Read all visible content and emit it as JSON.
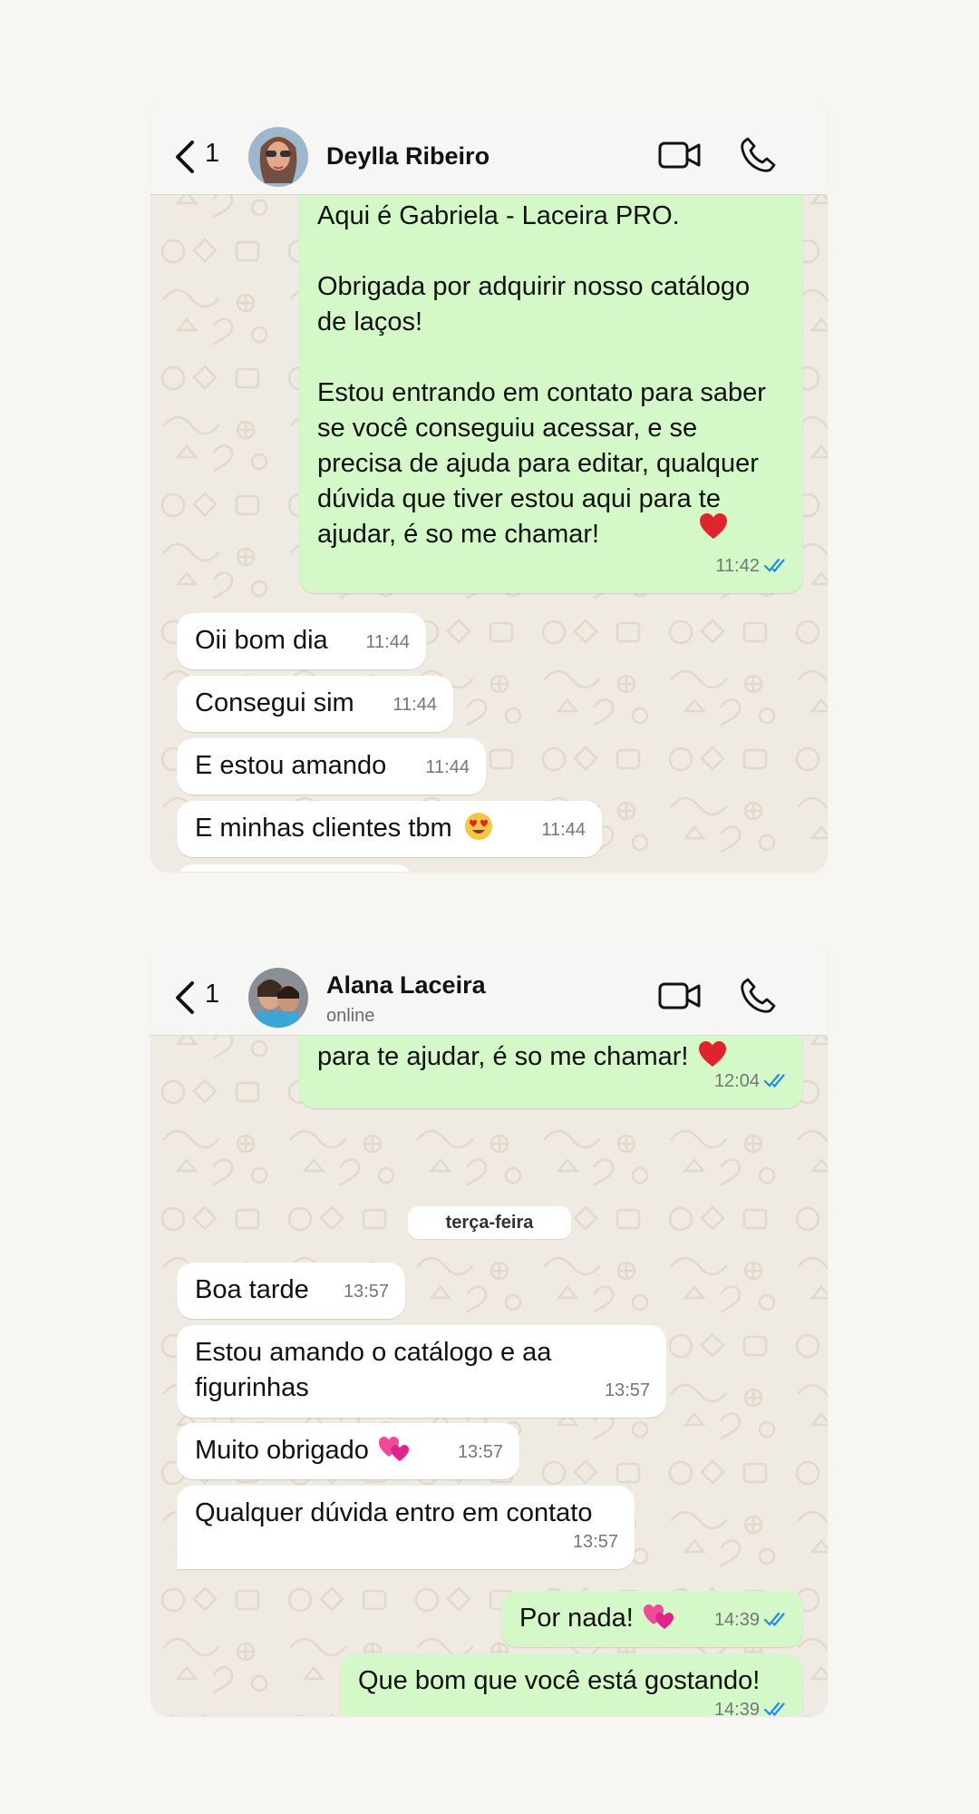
{
  "chats": [
    {
      "contact": {
        "name": "Deylla Ribeiro",
        "status": ""
      },
      "back_count": "1",
      "messages": [
        {
          "text": "Aqui é Gabriela - Laceira PRO.\n\nObrigada por adquirir nosso catálogo de laços!\n\nEstou entrando em contato para saber se você conseguiu acessar, e se precisa de ajuda para editar, qualquer dúvida que tiver estou aqui para te ajudar, é so me chamar!",
          "emoji": "heart",
          "time": "11:42",
          "direction": "outgoing"
        },
        {
          "text": "Oii bom dia",
          "time": "11:44",
          "direction": "incoming"
        },
        {
          "text": "Consegui sim",
          "time": "11:44",
          "direction": "incoming"
        },
        {
          "text": "E estou amando",
          "time": "11:44",
          "direction": "incoming"
        },
        {
          "text": "E minhas clientes tbm",
          "emoji": "heart-eyes",
          "time": "11:44",
          "direction": "incoming"
        }
      ]
    },
    {
      "contact": {
        "name": "Alana Laceira",
        "status": "online"
      },
      "back_count": "1",
      "date_separator": "terça-feira",
      "messages": [
        {
          "text": "para te ajudar, é so me chamar!",
          "emoji": "heart",
          "time": "12:04",
          "direction": "outgoing"
        },
        {
          "text": "Boa tarde",
          "time": "13:57",
          "direction": "incoming"
        },
        {
          "text": "Estou amando o catálogo e aa figurinhas",
          "time": "13:57",
          "direction": "incoming"
        },
        {
          "text": "Muito obrigado",
          "emoji": "two-hearts",
          "time": "13:57",
          "direction": "incoming"
        },
        {
          "text": "Qualquer dúvida entro em contato",
          "time": "13:57",
          "direction": "incoming"
        },
        {
          "text": "Por nada!",
          "emoji": "two-hearts",
          "time": "14:39",
          "direction": "outgoing"
        },
        {
          "text": "Que bom que você está gostando!",
          "time": "14:39",
          "direction": "outgoing"
        }
      ]
    }
  ],
  "icons": [
    "back-chevron-icon",
    "video-call-icon",
    "phone-icon",
    "read-ticks-icon"
  ],
  "colors": {
    "outgoing_bubble": "#d4f8c8",
    "incoming_bubble": "#ffffff",
    "chat_background": "#efeae2",
    "read_ticks": "#1d8cf0",
    "page_background": "#f7f6f3"
  }
}
